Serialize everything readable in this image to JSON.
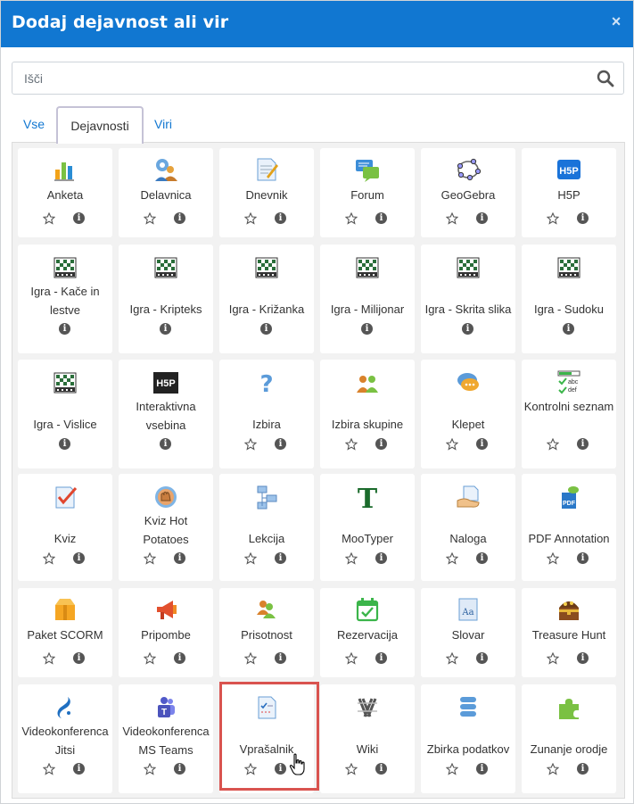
{
  "dialog": {
    "title": "Dodaj dejavnost ali vir",
    "close_label": "×"
  },
  "search": {
    "placeholder": "Išči"
  },
  "tabs": [
    "Vse",
    "Dejavnosti",
    "Viri"
  ],
  "colors": {
    "header": "#1177d1",
    "link": "#1177d1",
    "highlight": "#d9534f"
  },
  "rows": [
    [
      {
        "label": "Anketa",
        "icon": "bar-chart-icon",
        "star": true
      },
      {
        "label": "Delavnica",
        "icon": "workshop-icon",
        "star": true
      },
      {
        "label": "Dnevnik",
        "icon": "journal-icon",
        "star": true
      },
      {
        "label": "Forum",
        "icon": "forum-icon",
        "star": true
      },
      {
        "label": "GeoGebra",
        "icon": "geogebra-icon",
        "star": true
      },
      {
        "label": "H5P",
        "icon": "h5p-icon",
        "star": true
      }
    ],
    [
      {
        "label": "Igra - Kače in lestve",
        "icon": "game-icon",
        "star": false
      },
      {
        "label": "Igra - Kripteks",
        "icon": "game-icon",
        "star": false
      },
      {
        "label": "Igra - Križanka",
        "icon": "game-icon",
        "star": false
      },
      {
        "label": "Igra - Milijonar",
        "icon": "game-icon",
        "star": false
      },
      {
        "label": "Igra - Skrita slika",
        "icon": "game-icon",
        "star": false
      },
      {
        "label": "Igra - Sudoku",
        "icon": "game-icon",
        "star": false
      }
    ],
    [
      {
        "label": "Igra - Vislice",
        "icon": "game-icon",
        "star": false
      },
      {
        "label": "Interaktivna vsebina",
        "icon": "h5p-dark-icon",
        "star": false
      },
      {
        "label": "Izbira",
        "icon": "question-icon",
        "star": true
      },
      {
        "label": "Izbira skupine",
        "icon": "group-icon",
        "star": true
      },
      {
        "label": "Klepet",
        "icon": "chat-icon",
        "star": true
      },
      {
        "label": "Kontrolni seznam",
        "icon": "checklist-icon",
        "star": true
      }
    ],
    [
      {
        "label": "Kviz",
        "icon": "quiz-icon",
        "star": true
      },
      {
        "label": "Kviz Hot Potatoes",
        "icon": "hotpot-icon",
        "star": true
      },
      {
        "label": "Lekcija",
        "icon": "lesson-icon",
        "star": true
      },
      {
        "label": "MooTyper",
        "icon": "mootyper-icon",
        "star": true
      },
      {
        "label": "Naloga",
        "icon": "assignment-icon",
        "star": true
      },
      {
        "label": "PDF Annotation",
        "icon": "pdf-icon",
        "star": true
      }
    ],
    [
      {
        "label": "Paket SCORM",
        "icon": "scorm-icon",
        "star": true
      },
      {
        "label": "Pripombe",
        "icon": "megaphone-icon",
        "star": true
      },
      {
        "label": "Prisotnost",
        "icon": "attendance-icon",
        "star": true
      },
      {
        "label": "Rezervacija",
        "icon": "calendar-icon",
        "star": true
      },
      {
        "label": "Slovar",
        "icon": "glossary-icon",
        "star": true
      },
      {
        "label": "Treasure Hunt",
        "icon": "treasure-icon",
        "star": true
      }
    ],
    [
      {
        "label": "Videokonferenca Jitsi",
        "icon": "jitsi-icon",
        "star": true
      },
      {
        "label": "Videokonferenca MS Teams",
        "icon": "teams-icon",
        "star": true
      },
      {
        "label": "Vprašalnik",
        "icon": "questionnaire-icon",
        "star": true
      },
      {
        "label": "Wiki",
        "icon": "wiki-icon",
        "star": true
      },
      {
        "label": "Zbirka podatkov",
        "icon": "database-icon",
        "star": true
      },
      {
        "label": "Zunanje orodje",
        "icon": "puzzle-icon",
        "star": true
      }
    ]
  ]
}
